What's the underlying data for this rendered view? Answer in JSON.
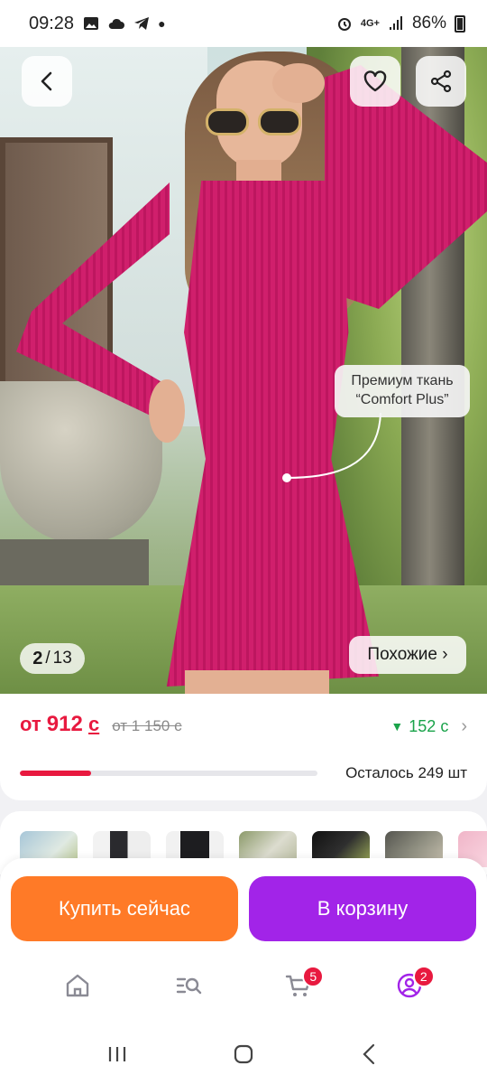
{
  "status_bar": {
    "time": "09:28",
    "network": "4G+",
    "battery": "86%"
  },
  "product": {
    "fabric_callout": {
      "line1": "Премиум ткань",
      "line2": "“Comfort Plus”"
    },
    "pager": {
      "current": "2",
      "total": "13",
      "separator": "/"
    },
    "similar_label": "Похожие ›"
  },
  "pricing": {
    "price_prefix": "от",
    "price": "912",
    "currency": "с",
    "old_price": "от 1 150 с",
    "cashback": "152 с",
    "stock_progress": 0.24,
    "stock_text": "Осталось 249 шт"
  },
  "actions": {
    "buy_now": "Купить сейчас",
    "add_to_cart": "В корзину"
  },
  "nav": {
    "cart_badge": "5",
    "profile_badge": "2"
  },
  "colors": {
    "accent_red": "#e8193f",
    "buy_orange": "#ff7a27",
    "cart_purple": "#a224e8",
    "cashback_green": "#1aa34a"
  }
}
